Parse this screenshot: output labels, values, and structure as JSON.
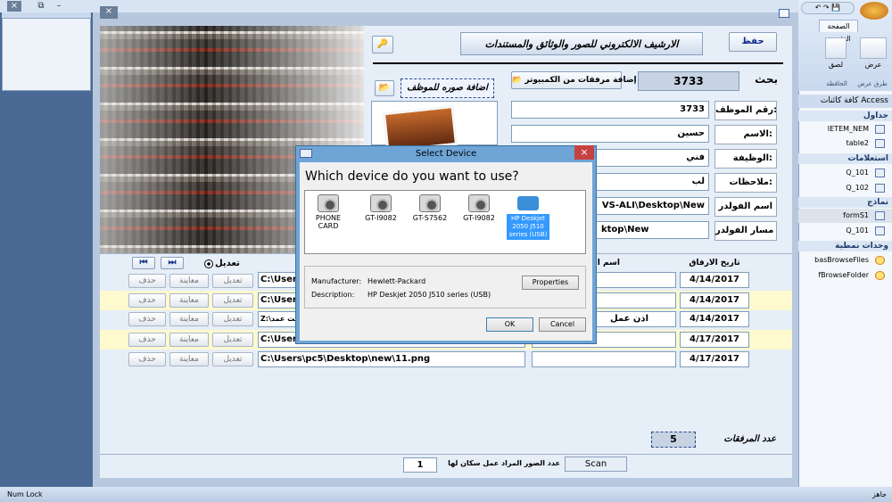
{
  "window": {
    "close": "×",
    "restore": "⧉",
    "minimize": "–"
  },
  "inner_close": "×",
  "form": {
    "title": "الارشيف الالكتروني للصور والوثائق والمستندات",
    "save_btn": "حفظ",
    "search_label": "بحث",
    "search_value": "3733",
    "add_files_btn": "إضافة مرفقات من الكمبيوتر",
    "add_photo_btn": "اضافة صوره للموظف",
    "emp_no_label": "رقم الموظف:",
    "emp_no_value": "3733",
    "name_label": "الاسم:",
    "name_value": "حسين",
    "job_label": "الوظيفة:",
    "job_value": "فني",
    "notes_label": "ملاحظات:",
    "notes_value": "لب",
    "folder_name_label": "اسم الفولدر",
    "folder_name_value": "VS-ALI\\Desktop\\New",
    "folder_path_label": "مسار الفولدر",
    "folder_path_value": "ktop\\New"
  },
  "detail": {
    "edit_label": "تعديل",
    "col_date": "تاريخ الارفاق",
    "col_name": "اسم الص",
    "rows": [
      {
        "path": "C:\\Users",
        "mid": "",
        "date": "4/14/2017"
      },
      {
        "path": "C:\\Users",
        "mid": "",
        "date": "4/14/2017"
      },
      {
        "path": "Z:\\بخيت عمد",
        "mid": "اذن عمل",
        "date": "4/14/2017"
      },
      {
        "path": "C:\\Users",
        "mid": "",
        "date": "4/17/2017"
      },
      {
        "path": "C:\\Users\\pc5\\Desktop\\new\\11.png",
        "mid": "",
        "date": "4/17/2017"
      }
    ],
    "row_edit": "تعديل",
    "row_preview": "معاينة",
    "row_delete": "حذف",
    "attach_count_label": "عدد المرفقات",
    "attach_count": "5"
  },
  "footer": {
    "scan_btn": "Scan",
    "pages_label": "عدد الصور المراد عمل سكان لها",
    "pages_value": "1"
  },
  "dialog": {
    "title": "Select Device",
    "question": "Which device do you want to use?",
    "devices": [
      "PHONE CARD",
      "GT-I9082",
      "GT-S7562",
      "GT-I9082",
      "HP Deskjet 2050 J510 series (USB)"
    ],
    "manufacturer_label": "Manufacturer:",
    "manufacturer_value": "Hewlett-Packard",
    "description_label": "Description:",
    "description_value": "HP Deskjet 2050 J510 series (USB)",
    "properties_btn": "Properties",
    "ok_btn": "OK",
    "cancel_btn": "Cancel",
    "close": "×"
  },
  "nav": {
    "header": "كافة كائنات Access",
    "ribbon_tab": "الصفحة الرئيسية",
    "ribbon_view": "عرض",
    "ribbon_views_group": "طرق عرض",
    "ribbon_clipboard_group": "الحافظة",
    "ribbon_paste": "لصق",
    "groups": [
      {
        "name": "جداول",
        "items": [
          "IETEM_NEM",
          "table2"
        ]
      },
      {
        "name": "استعلامات",
        "items": [
          "Q_101",
          "Q_102"
        ]
      },
      {
        "name": "نماذج",
        "items": [
          "formS1",
          "Q_101"
        ]
      },
      {
        "name": "وحدات نمطية",
        "items": [
          "basBrowseFiles",
          "fBrowseFolder"
        ]
      }
    ]
  },
  "status": {
    "left": "Num Lock",
    "right": "جاهز"
  }
}
